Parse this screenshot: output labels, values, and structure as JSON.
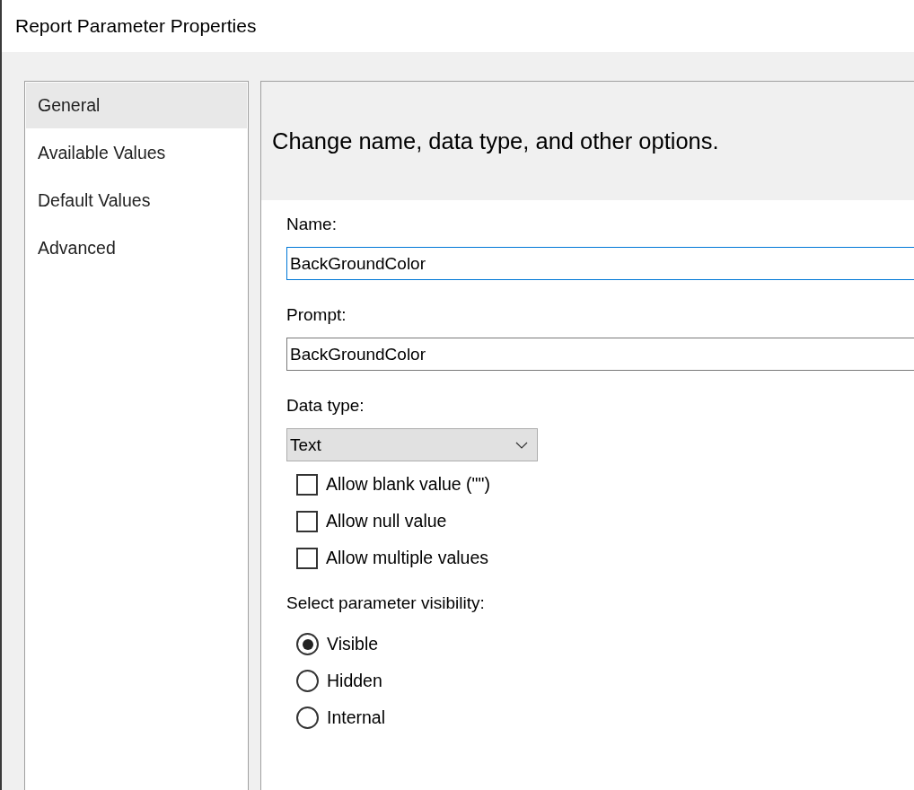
{
  "window": {
    "title": "Report Parameter Properties"
  },
  "sidebar": {
    "items": [
      {
        "label": "General",
        "selected": true
      },
      {
        "label": "Available Values",
        "selected": false
      },
      {
        "label": "Default Values",
        "selected": false
      },
      {
        "label": "Advanced",
        "selected": false
      }
    ]
  },
  "panel": {
    "heading": "Change name, data type, and other options.",
    "fields": [
      {
        "label": "Name:",
        "value": "BackGroundColor",
        "focused": true
      },
      {
        "label": "Prompt:",
        "value": "BackGroundColor",
        "focused": false
      }
    ],
    "data_type": {
      "label": "Data type:",
      "value": "Text"
    },
    "checkboxes": [
      {
        "label": "Allow blank value (\"\")",
        "checked": false
      },
      {
        "label": "Allow null value",
        "checked": false
      },
      {
        "label": "Allow multiple values",
        "checked": false
      }
    ],
    "visibility": {
      "label": "Select parameter visibility:",
      "options": [
        {
          "label": "Visible",
          "selected": true
        },
        {
          "label": "Hidden",
          "selected": false
        },
        {
          "label": "Internal",
          "selected": false
        }
      ]
    }
  }
}
